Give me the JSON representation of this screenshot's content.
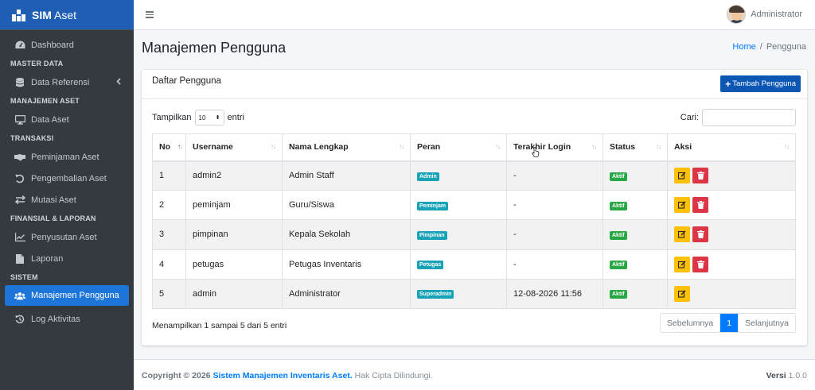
{
  "brand": {
    "name_bold": "SIM",
    "name_rest": " Aset"
  },
  "topbar": {
    "user_name": "Administrator"
  },
  "sidebar": {
    "dashboard": "Dashboard",
    "master_header": "MASTER DATA",
    "data_referensi": "Data Referensi",
    "aset_header": "MANAJEMEN ASET",
    "data_aset": "Data Aset",
    "transaksi_header": "TRANSAKSI",
    "peminjaman": "Peminjaman Aset",
    "pengembalian": "Pengembalian Aset",
    "mutasi": "Mutasi Aset",
    "finansial_header": "FINANSIAL & LAPORAN",
    "penyusutan": "Penyusutan Aset",
    "laporan": "Laporan",
    "sistem_header": "SISTEM",
    "manajemen_pengguna": "Manajemen Pengguna",
    "log": "Log Aktivitas"
  },
  "page": {
    "title": "Manajemen Pengguna"
  },
  "breadcrumb": {
    "home": "Home",
    "sep": "/",
    "current": "Pengguna"
  },
  "card": {
    "title": "Daftar Pengguna",
    "add_button": "Tambah Pengguna",
    "show_label": "Tampilkan",
    "show_value": "10",
    "entries_label": "entri",
    "search_label": "Cari:"
  },
  "table": {
    "headers": {
      "no": "No",
      "username": "Username",
      "nama": "Nama Lengkap",
      "peran": "Peran",
      "login": "Terakhir Login",
      "status": "Status",
      "aksi": "Aksi"
    },
    "rows": [
      {
        "no": "1",
        "username": "admin2",
        "nama": "Admin Staff",
        "peran": "Admin",
        "login": "-",
        "status": "Aktif"
      },
      {
        "no": "2",
        "username": "peminjam",
        "nama": "Guru/Siswa",
        "peran": "Peminjam",
        "login": "-",
        "status": "Aktif"
      },
      {
        "no": "3",
        "username": "pimpinan",
        "nama": "Kepala Sekolah",
        "peran": "Pimpinan",
        "login": "-",
        "status": "Aktif"
      },
      {
        "no": "4",
        "username": "petugas",
        "nama": "Petugas Inventaris",
        "peran": "Petugas",
        "login": "-",
        "status": "Aktif"
      },
      {
        "no": "5",
        "username": "admin",
        "nama": "Administrator",
        "peran": "Superadmin",
        "login": "12-08-2026 11:56",
        "status": "Aktif"
      }
    ]
  },
  "info": "Menampilkan 1 sampai 5 dari 5 entri",
  "pagination": {
    "prev": "Sebelumnya",
    "current": "1",
    "next": "Selanjutnya"
  },
  "footer": {
    "copyright": "Copyright © 2026",
    "system": "Sistem Manajemen Inventaris Aset.",
    "rights": "Hak Cipta Dilindungi.",
    "version_label": "Versi",
    "version": "1.0.0"
  },
  "colors": {
    "sidebar_bg": "#343a40",
    "brand_bg": "#1f5fb3",
    "active": "#1e75d8",
    "primary": "#0b57b3",
    "warning": "#ffc107",
    "danger": "#dc3545",
    "info": "#17a2b8",
    "success": "#28a745"
  }
}
